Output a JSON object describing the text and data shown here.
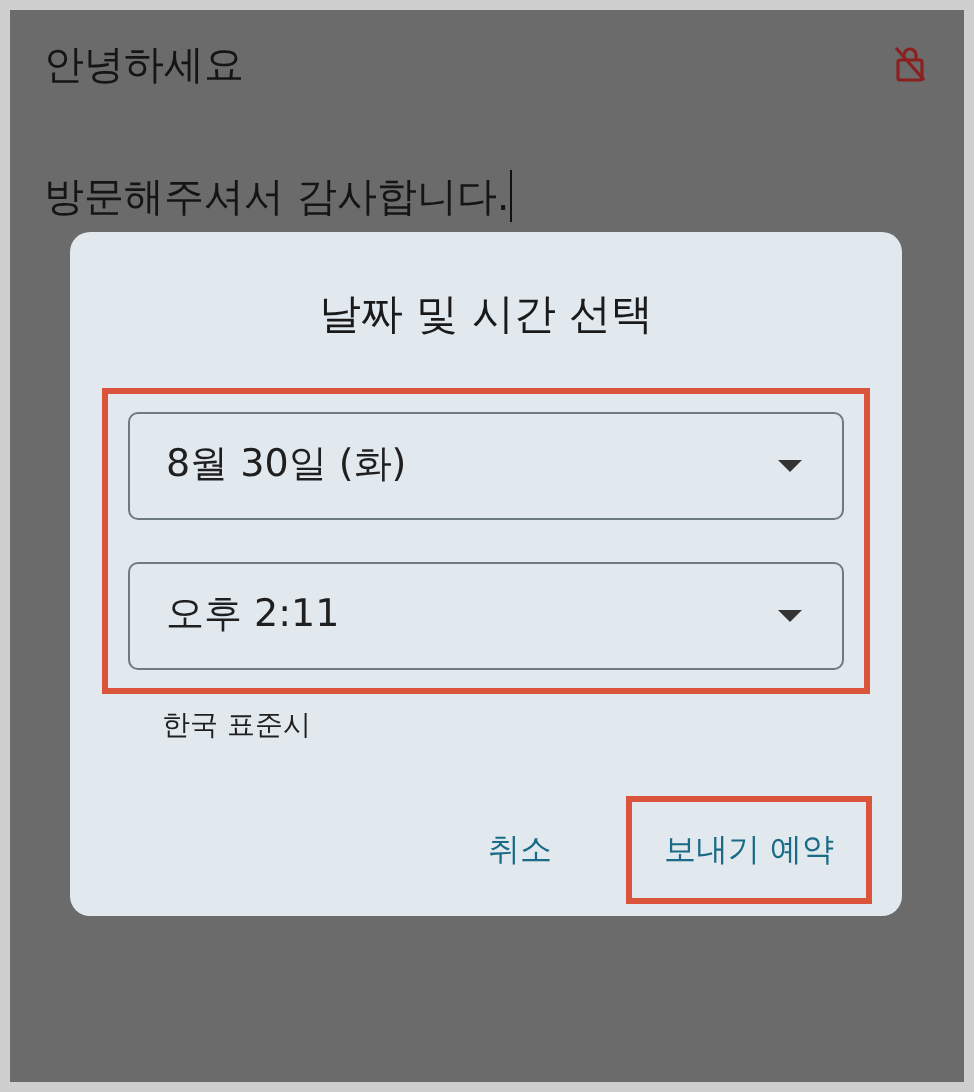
{
  "note": {
    "title": "안녕하세요",
    "body": "방문해주셔서 감사합니다."
  },
  "dialog": {
    "title": "날짜 및 시간 선택",
    "pickers_highlighted": true,
    "pickers": [
      {
        "value": "8월 30일 (화)"
      },
      {
        "value": "오후 2:11"
      }
    ],
    "timezone": "한국 표준시",
    "actions": [
      {
        "label": "취소",
        "highlighted": false
      },
      {
        "label": "보내기 예약",
        "highlighted": true
      }
    ]
  }
}
